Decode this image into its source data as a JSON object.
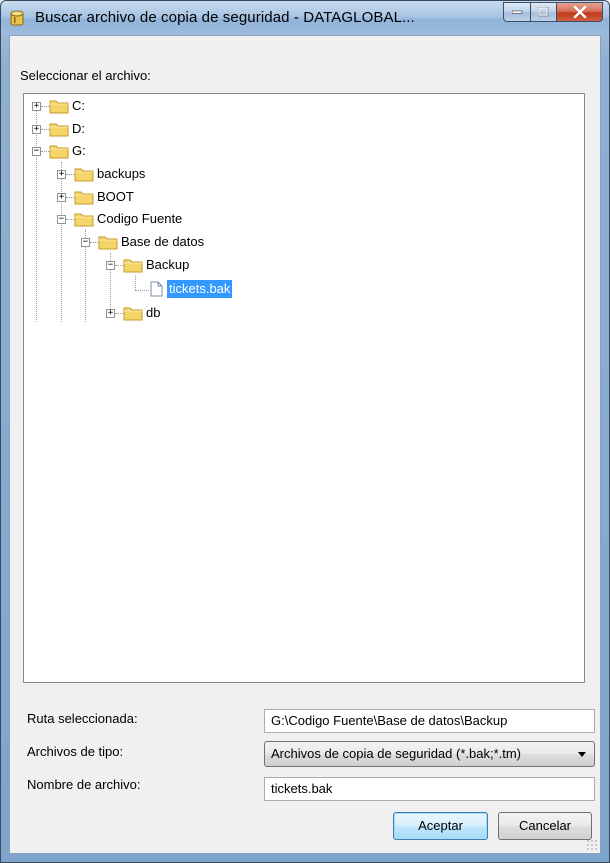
{
  "window": {
    "title": "Buscar archivo de copia de seguridad - DATAGLOBAL..."
  },
  "labels": {
    "select_file": "Seleccionar el archivo:",
    "selected_path": "Ruta seleccionada:",
    "file_type": "Archivos de tipo:",
    "file_name": "Nombre de archivo:"
  },
  "tree": {
    "nodes": [
      {
        "label": "C:",
        "expander": "+"
      },
      {
        "label": "D:",
        "expander": "+"
      },
      {
        "label": "G:",
        "expander": "−"
      },
      {
        "label": "backups",
        "expander": "+"
      },
      {
        "label": "BOOT",
        "expander": "+"
      },
      {
        "label": "Codigo Fuente",
        "expander": "−"
      },
      {
        "label": "Base de datos",
        "expander": "−"
      },
      {
        "label": "Backup",
        "expander": "−"
      },
      {
        "label": "tickets.bak",
        "selected": true
      },
      {
        "label": "db",
        "expander": "+"
      }
    ]
  },
  "fields": {
    "selected_path_value": "G:\\Codigo Fuente\\Base de datos\\Backup",
    "file_type_value": "Archivos de copia de seguridad (*.bak;*.tm)",
    "file_name_value": "tickets.bak"
  },
  "buttons": {
    "accept": "Aceptar",
    "cancel": "Cancelar"
  },
  "colors": {
    "selection": "#3399ff",
    "folder": "#f5d46a"
  }
}
